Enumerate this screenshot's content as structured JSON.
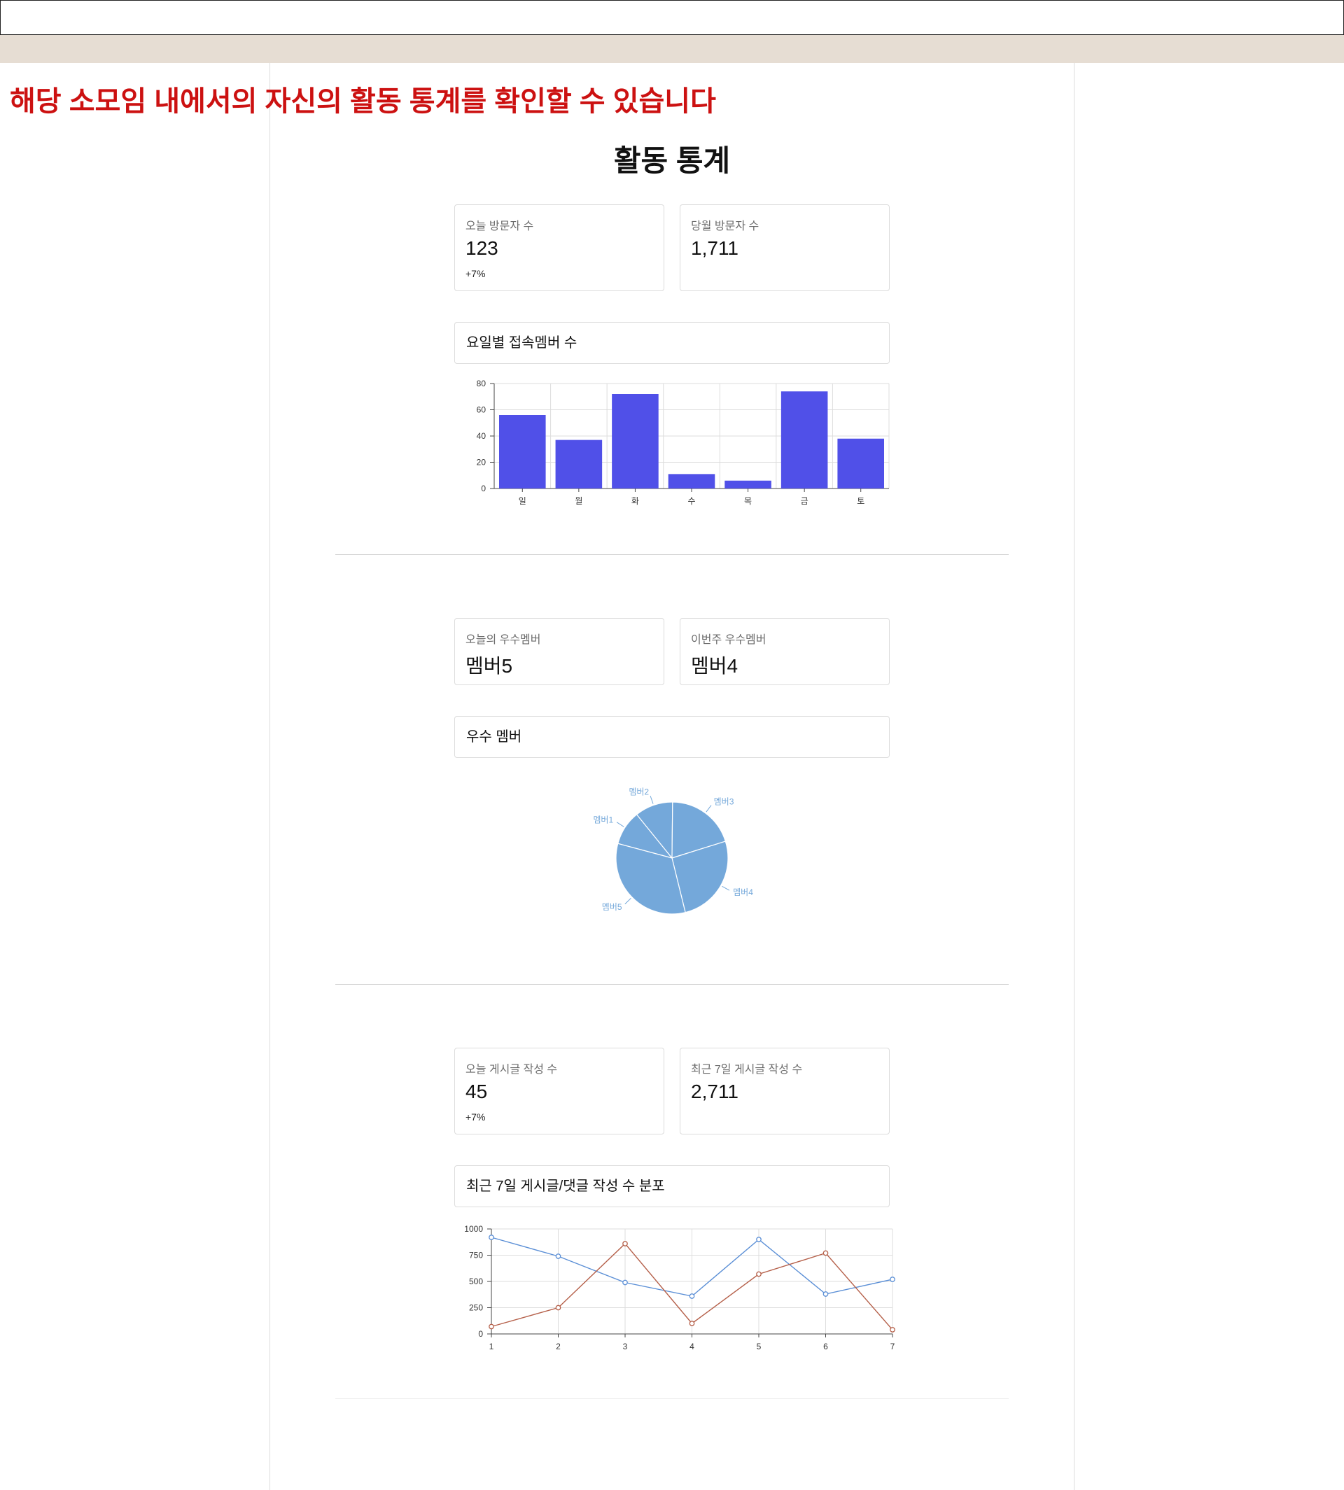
{
  "annotation": "해당 소모임 내에서의 자신의 활동 통계를 확인할 수 있습니다",
  "page_title": "활동 통계",
  "visitors": {
    "today": {
      "label": "오늘 방문자 수",
      "value": "123",
      "delta": "+7%"
    },
    "month": {
      "label": "당월 방문자 수",
      "value": "1,711"
    },
    "chart_title": "요일별 접속멤버 수"
  },
  "members": {
    "today_best": {
      "label": "오늘의 우수멤버",
      "value": "멤버5"
    },
    "week_best": {
      "label": "이번주 우수멤버",
      "value": "멤버4"
    },
    "chart_title": "우수 멤버"
  },
  "posts": {
    "today": {
      "label": "오늘 게시글 작성 수",
      "value": "45",
      "delta": "+7%"
    },
    "week": {
      "label": "최근 7일 게시글 작성 수",
      "value": "2,711"
    },
    "chart_title": "최근 7일 게시글/댓글 작성 수 분포"
  },
  "colors": {
    "bar": "#5050e8",
    "pie": "#74a8da",
    "line_blue": "#5b8fd6",
    "line_red": "#b5604a",
    "annotation": "#cc1111"
  },
  "chart_data": [
    {
      "type": "bar",
      "categories": [
        "일",
        "월",
        "화",
        "수",
        "목",
        "금",
        "토"
      ],
      "values": [
        56,
        37,
        72,
        11,
        6,
        74,
        38
      ],
      "ylim": [
        0,
        80
      ],
      "yticks": [
        0,
        20,
        40,
        60,
        80
      ],
      "grid": true
    },
    {
      "type": "pie",
      "labels": [
        "멤버1",
        "멤버2",
        "멤버3",
        "멤버4",
        "멤버5"
      ],
      "values": [
        10,
        11,
        20,
        26,
        33
      ]
    },
    {
      "type": "line",
      "x": [
        1,
        2,
        3,
        4,
        5,
        6,
        7
      ],
      "ylim": [
        0,
        1000
      ],
      "yticks": [
        0,
        250,
        500,
        750,
        1000
      ],
      "grid": true,
      "series": [
        {
          "values": [
            920,
            740,
            490,
            360,
            900,
            380,
            520
          ]
        },
        {
          "values": [
            70,
            250,
            860,
            100,
            570,
            770,
            40
          ]
        }
      ]
    }
  ]
}
